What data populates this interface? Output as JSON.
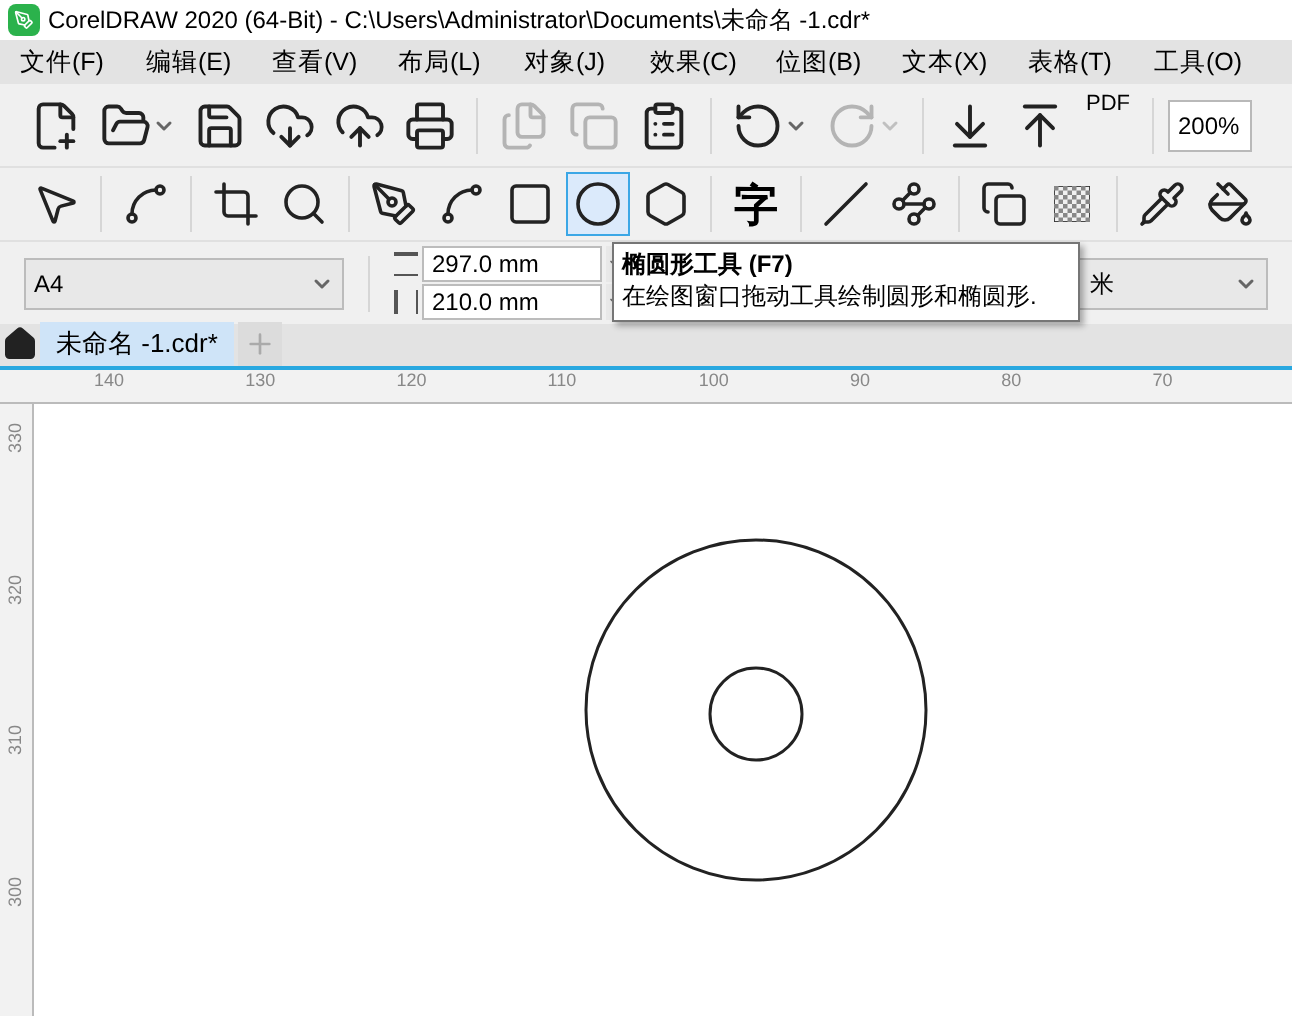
{
  "window": {
    "title": "CorelDRAW 2020 (64-Bit) - C:\\Users\\Administrator\\Documents\\未命名 -1.cdr*"
  },
  "menu": [
    "文件(F)",
    "编辑(E)",
    "查看(V)",
    "布局(L)",
    "对象(J)",
    "效果(C)",
    "位图(B)",
    "文本(X)",
    "表格(T)",
    "工具(O)"
  ],
  "standard_toolbar": {
    "buttons": [
      {
        "disabled": false
      },
      {
        "disabled": false
      },
      {
        "disabled": false
      },
      {
        "disabled": false
      },
      {
        "disabled": false
      },
      {
        "disabled": false
      },
      {
        "disabled": true
      },
      {
        "disabled": true
      },
      {
        "disabled": false
      },
      {
        "disabled": false
      },
      {
        "disabled": true
      },
      {
        "disabled": false
      },
      {
        "disabled": false
      }
    ],
    "pdf_label": "PDF",
    "zoom_level": "200%"
  },
  "toolbox": {
    "tools": [
      {
        "selected": false
      },
      {
        "selected": false
      },
      {
        "selected": false
      },
      {
        "selected": false
      },
      {
        "selected": false
      },
      {
        "selected": false
      },
      {
        "selected": false
      },
      {
        "selected": true
      },
      {
        "selected": false
      },
      {
        "selected": false,
        "glyph": "字"
      },
      {
        "selected": false
      },
      {
        "selected": false
      },
      {
        "selected": false
      },
      {
        "selected": false
      },
      {
        "selected": false
      },
      {
        "selected": false
      }
    ]
  },
  "property_bar": {
    "page_size": "A4",
    "width": "297.0 mm",
    "height": "210.0 mm",
    "units": "米"
  },
  "tooltip": {
    "title": "椭圆形工具 (F7)",
    "description": "在绘图窗口拖动工具绘制圆形和椭圆形."
  },
  "document_tabs": [
    {
      "label": "未命名 -1.cdr*",
      "selected": true
    }
  ],
  "horizontal_ruler": [
    "140",
    "130",
    "120",
    "110",
    "100",
    "90",
    "80",
    "70"
  ],
  "vertical_ruler": [
    "330",
    "320",
    "310",
    "300"
  ]
}
